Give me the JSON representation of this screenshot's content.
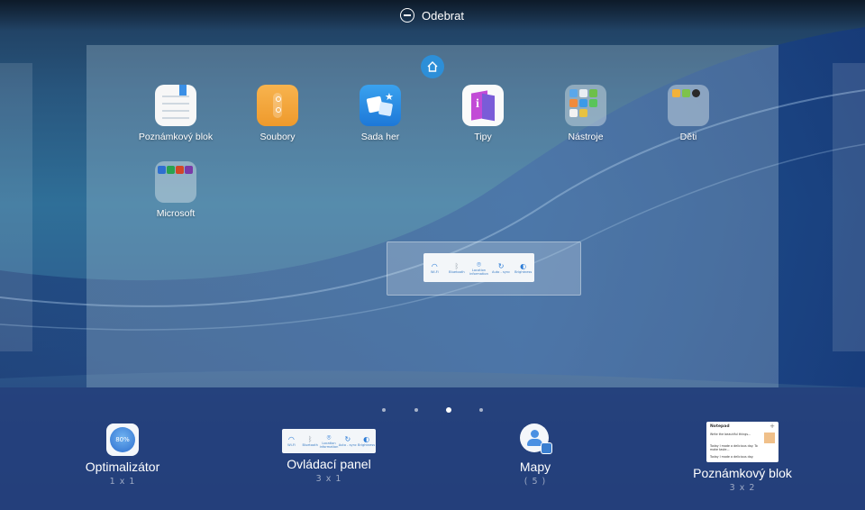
{
  "top_bar": {
    "remove_label": "Odebrat"
  },
  "home_apps": [
    {
      "label": "Poznámkový blok",
      "icon": "notepad-icon"
    },
    {
      "label": "Soubory",
      "icon": "files-icon"
    },
    {
      "label": "Sada her",
      "icon": "game-suite-icon"
    },
    {
      "label": "Tipy",
      "icon": "tips-icon"
    },
    {
      "label": "Nástroje",
      "icon": "tools-folder-icon"
    },
    {
      "label": "Děti",
      "icon": "kids-folder-icon"
    },
    {
      "label": "Microsoft",
      "icon": "microsoft-folder-icon"
    }
  ],
  "control_widget": {
    "cells": [
      {
        "icon": "wifi-icon",
        "label": "Wi-Fi"
      },
      {
        "icon": "bluetooth-icon",
        "label": "Bluetooth"
      },
      {
        "icon": "location-icon",
        "label": "Location information"
      },
      {
        "icon": "auto-sync-icon",
        "label": "Auto - sync"
      },
      {
        "icon": "brightness-icon",
        "label": "Brightness"
      }
    ]
  },
  "page_indicator": {
    "count": 4,
    "active_index": 2
  },
  "widgets": [
    {
      "name": "Optimalizátor",
      "size": "1 x 1",
      "preview_text": "80%"
    },
    {
      "name": "Ovládací panel",
      "size": "3 x 1"
    },
    {
      "name": "Mapy",
      "size": "( 5 )"
    },
    {
      "name": "Poznámkový blok",
      "size": "3 x 2",
      "preview": {
        "title": "Notepad",
        "note1": "Write the beautiful things...",
        "note2": "Today I made a delicious day. To make taste...",
        "note3": "Today I made a delicious day."
      }
    }
  ],
  "colors": {
    "accent": "#2d8fd8",
    "files_orange": "#f3a53b",
    "tips_purple": "#b83fd0"
  }
}
